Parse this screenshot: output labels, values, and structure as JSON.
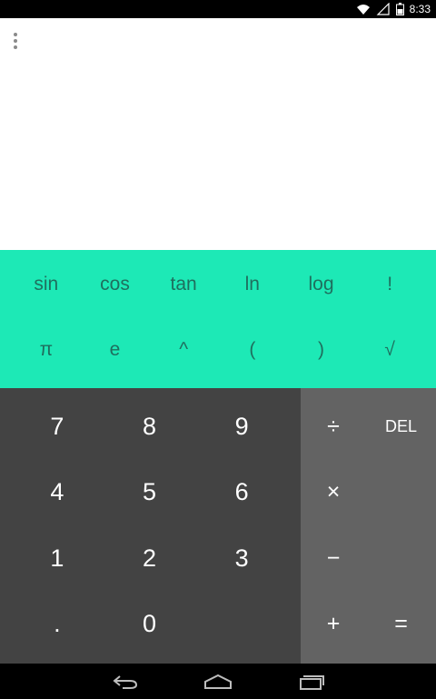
{
  "status_bar": {
    "time": "8:33",
    "icons": [
      "wifi-icon",
      "signal-icon",
      "battery-icon"
    ]
  },
  "display": {
    "menu_icon": "overflow-menu-icon"
  },
  "advanced_pad": {
    "background": "#1de9b6",
    "row1": [
      "sin",
      "cos",
      "tan",
      "ln",
      "log",
      "!"
    ],
    "row2": [
      "π",
      "e",
      "^",
      "(",
      ")",
      "√"
    ]
  },
  "number_pad": {
    "keys": [
      "7",
      "8",
      "9",
      "4",
      "5",
      "6",
      "1",
      "2",
      "3",
      ".",
      "0",
      ""
    ]
  },
  "operator_pad": {
    "divide": "÷",
    "delete": "DEL",
    "multiply": "×",
    "minus": "−",
    "plus": "+",
    "equals": "="
  },
  "nav_bar": {
    "icons": [
      "back-icon",
      "home-icon",
      "recents-icon"
    ]
  }
}
